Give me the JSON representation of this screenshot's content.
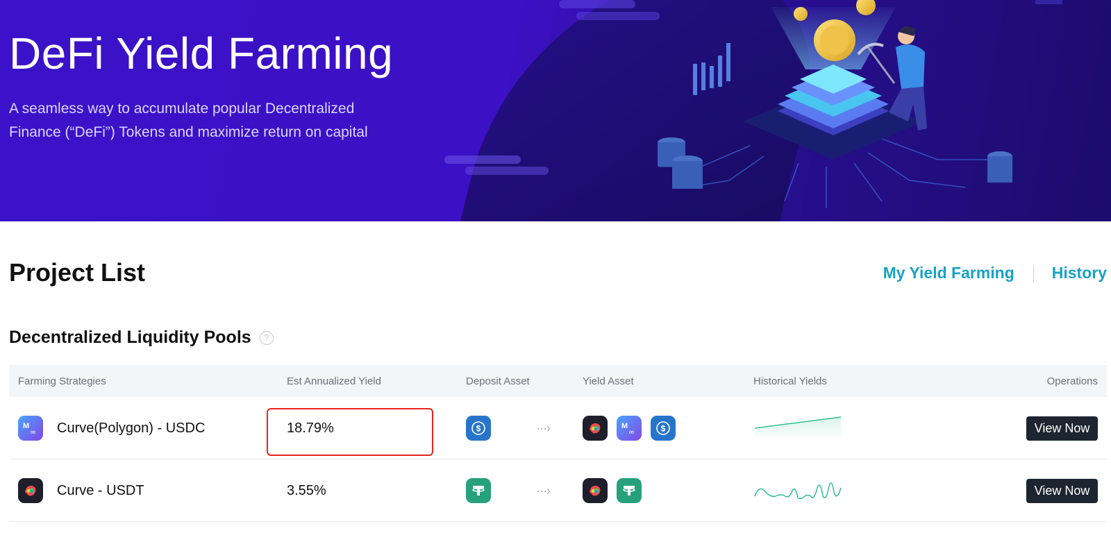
{
  "hero": {
    "title": "DeFi Yield Farming",
    "subtitle_line1": "A seamless way to accumulate popular Decentralized",
    "subtitle_line2": "Finance (“DeFi”) Tokens and maximize return on capital"
  },
  "project_list": {
    "title": "Project List",
    "links": {
      "my_yield_farming": "My Yield Farming",
      "history": "History"
    }
  },
  "section": {
    "title": "Decentralized Liquidity Pools",
    "help_icon": "?"
  },
  "table": {
    "headers": {
      "strategy": "Farming Strategies",
      "yield": "Est Annualized Yield",
      "deposit": "Deposit Asset",
      "yield_asset": "Yield Asset",
      "history": "Historical Yields",
      "operations": "Operations"
    },
    "rows": [
      {
        "strategy": "Curve(Polygon) - USDC",
        "strategy_icon": "polygon-icon",
        "yield": "18.79%",
        "deposit": [
          "usdc-icon"
        ],
        "yield_assets": [
          "curve-icon",
          "polygon-icon",
          "usdc-icon"
        ],
        "button": "View Now"
      },
      {
        "strategy": "Curve - USDT",
        "strategy_icon": "curve-icon",
        "yield": "3.55%",
        "deposit": [
          "usdt-icon"
        ],
        "yield_assets": [
          "curve-icon",
          "usdt-icon"
        ],
        "button": "View Now"
      }
    ]
  },
  "colors": {
    "hero_bg": "#3b12c9",
    "link": "#17a2c5",
    "button": "#1c2530",
    "highlight": "#e8231a",
    "usdc": "#2775ca",
    "usdt": "#26a17b",
    "polygon": "#8247e5",
    "curve": "#1e1f2b",
    "sparkline": "#2fbf8c"
  }
}
